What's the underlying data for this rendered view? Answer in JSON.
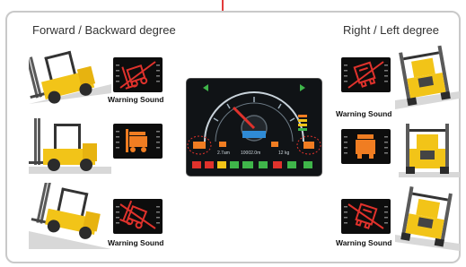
{
  "headings": {
    "forward_backward": "Forward / Backward degree",
    "right_left": "Right / Left degree"
  },
  "labels": {
    "warning_sound": "Warning Sound"
  },
  "dashboard": {
    "lcd_left": "2.7am",
    "lcd_mid": "10002.0m",
    "lcd_right": "12 kg"
  },
  "colors": {
    "warning_red": "#e0322c",
    "safe_orange": "#f07d22",
    "forklift_yellow": "#f2c418",
    "frame_border": "#c9c9c9",
    "lcd_blue": "#2f8bd6"
  }
}
